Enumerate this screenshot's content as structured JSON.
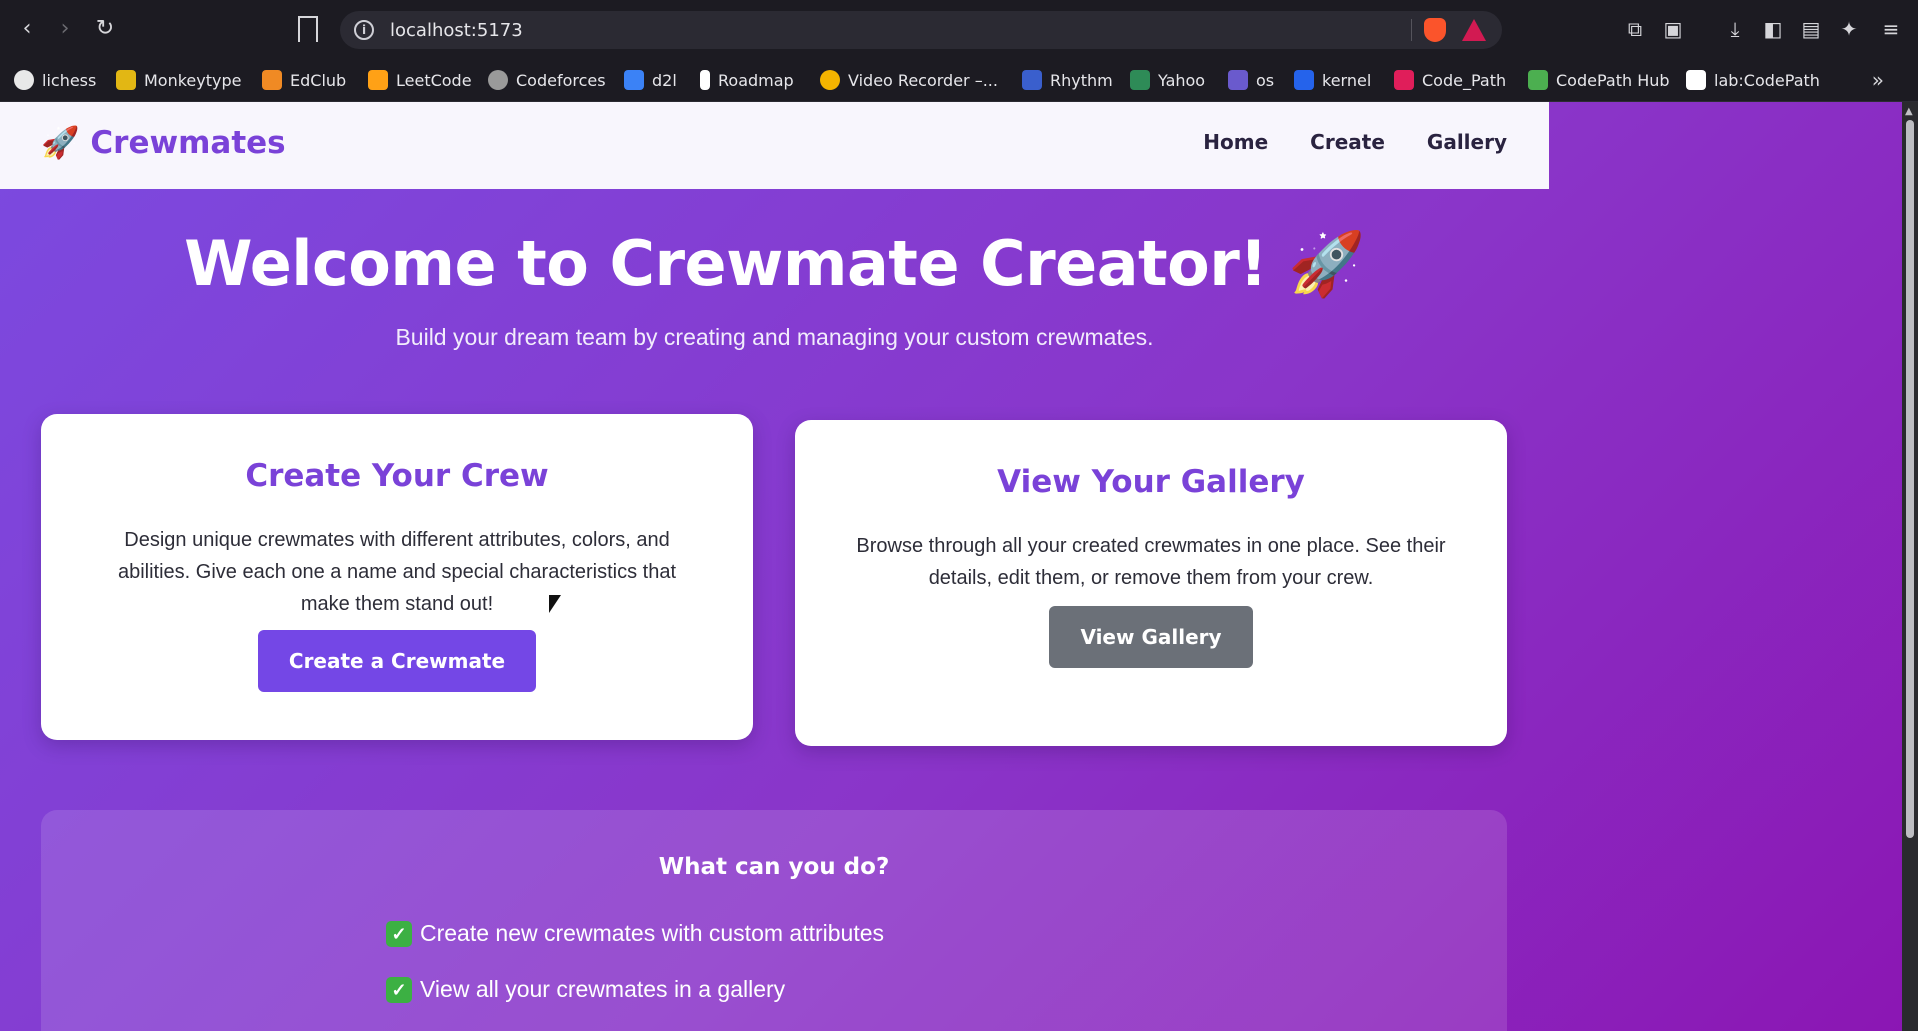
{
  "browser": {
    "url": "localhost:5173",
    "bookmarks": [
      {
        "label": "lichess",
        "color": "#e8e8e8"
      },
      {
        "label": "Monkeytype",
        "color": "#e2b714"
      },
      {
        "label": "EdClub",
        "color": "#f08a24"
      },
      {
        "label": "LeetCode",
        "color": "#ffa116"
      },
      {
        "label": "Codeforces",
        "color": "#9a9a9a"
      },
      {
        "label": "d2l",
        "color": "#3b82f6"
      },
      {
        "label": "Roadmap",
        "color": "#ffffff"
      },
      {
        "label": "Video Recorder –...",
        "color": "#f4b400"
      },
      {
        "label": "Rhythm",
        "color": "#3a5fcd"
      },
      {
        "label": "Yahoo",
        "color": "#2e8b57"
      },
      {
        "label": "os",
        "color": "#6a5acd"
      },
      {
        "label": "kernel",
        "color": "#2563eb"
      },
      {
        "label": "Code_Path",
        "color": "#e01e5a"
      },
      {
        "label": "CodePath Hub",
        "color": "#4caf50"
      },
      {
        "label": "lab:CodePath",
        "color": "#ffffff"
      }
    ]
  },
  "site": {
    "logo_emoji": "🚀",
    "logo_text": "Crewmates",
    "nav": [
      "Home",
      "Create",
      "Gallery"
    ]
  },
  "hero": {
    "title": "Welcome to Crewmate Creator! 🚀",
    "subtitle": "Build your dream team by creating and managing your custom crewmates."
  },
  "cards": [
    {
      "title": "Create Your Crew",
      "text": "Design unique crewmates with different attributes, colors, and abilities. Give each one a name and special characteristics that make them stand out!",
      "button": "Create a Crewmate"
    },
    {
      "title": "View Your Gallery",
      "text": "Browse through all your created crewmates in one place. See their details, edit them, or remove them from your crew.",
      "button": "View Gallery"
    }
  ],
  "features": {
    "title": "What can you do?",
    "items": [
      "Create new crewmates with custom attributes",
      "View all your crewmates in a gallery"
    ]
  }
}
